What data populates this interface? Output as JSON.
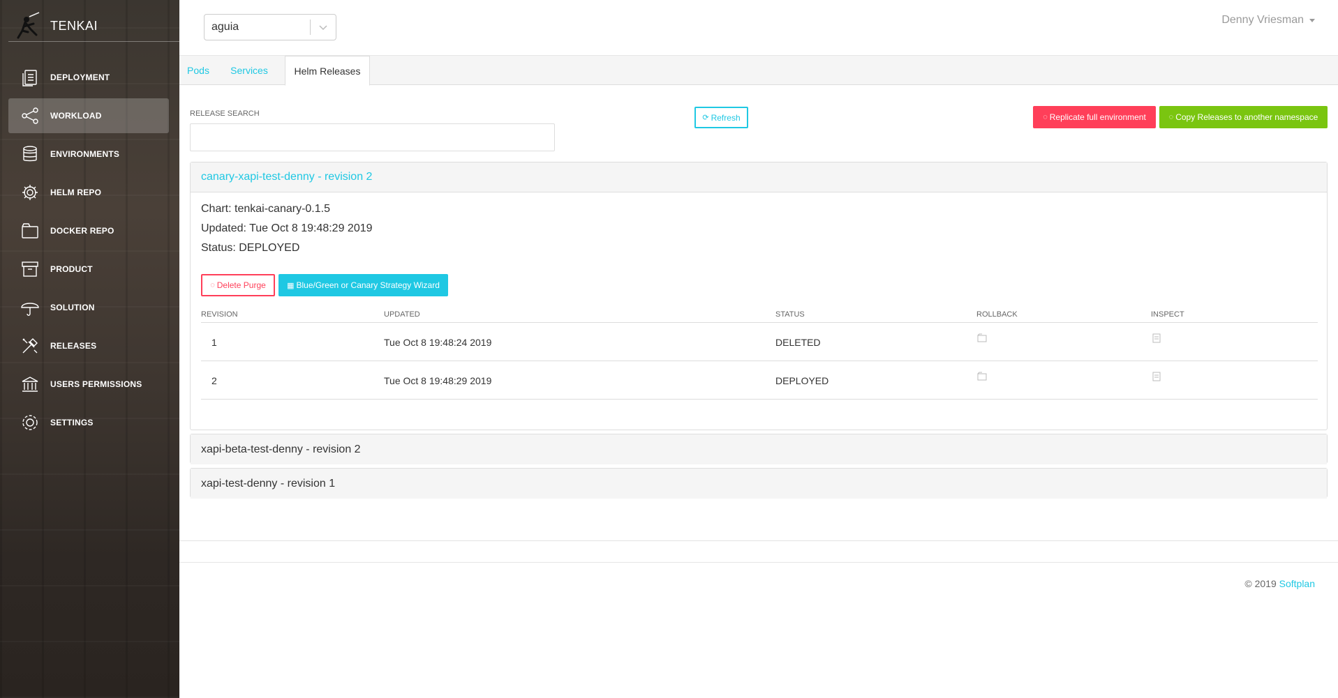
{
  "app": {
    "title": "TENKAI"
  },
  "sidebar": {
    "items": [
      {
        "label": "DEPLOYMENT",
        "icon": "document-stack-icon"
      },
      {
        "label": "WORKLOAD",
        "icon": "share-nodes-icon"
      },
      {
        "label": "ENVIRONMENTS",
        "icon": "database-icon"
      },
      {
        "label": "HELM REPO",
        "icon": "gear-icon"
      },
      {
        "label": "DOCKER REPO",
        "icon": "folder-icon"
      },
      {
        "label": "PRODUCT",
        "icon": "archive-box-icon"
      },
      {
        "label": "SOLUTION",
        "icon": "umbrella-icon"
      },
      {
        "label": "RELEASES",
        "icon": "tools-icon"
      },
      {
        "label": "USERS PERMISSIONS",
        "icon": "bank-icon"
      },
      {
        "label": "SETTINGS",
        "icon": "cog-icon"
      }
    ],
    "active_index": 1
  },
  "header": {
    "namespace": "aguia",
    "user": "Denny Vriesman"
  },
  "tabs": [
    {
      "label": "Pods"
    },
    {
      "label": "Services"
    },
    {
      "label": "Helm Releases",
      "active": true
    }
  ],
  "search": {
    "label": "RELEASE SEARCH",
    "value": ""
  },
  "actions": {
    "refresh": "Refresh",
    "replicate": "Replicate full environment",
    "copy": "Copy Releases to another namespace"
  },
  "releases": [
    {
      "title": "canary-xapi-test-denny - revision 2",
      "expanded": true,
      "chart": "Chart: tenkai-canary-0.1.5",
      "updated": "Updated: Tue Oct 8 19:48:29 2019",
      "status": "Status: DEPLOYED",
      "delete_label": "Delete Purge",
      "wizard_label": "Blue/Green or Canary Strategy Wizard",
      "history": {
        "columns": [
          "REVISION",
          "UPDATED",
          "STATUS",
          "ROLLBACK",
          "INSPECT"
        ],
        "rows": [
          {
            "revision": "1",
            "updated": "Tue Oct 8 19:48:24 2019",
            "status": "DELETED"
          },
          {
            "revision": "2",
            "updated": "Tue Oct 8 19:48:29 2019",
            "status": "DEPLOYED"
          }
        ]
      }
    },
    {
      "title": "xapi-beta-test-denny - revision 2",
      "expanded": false
    },
    {
      "title": "xapi-test-denny - revision 1",
      "expanded": false
    }
  ],
  "footer": {
    "copyright": "© 2019",
    "company": "Softplan"
  },
  "colors": {
    "accent": "#1fc8e3",
    "danger": "#ff3f59",
    "success": "#7ac510"
  }
}
